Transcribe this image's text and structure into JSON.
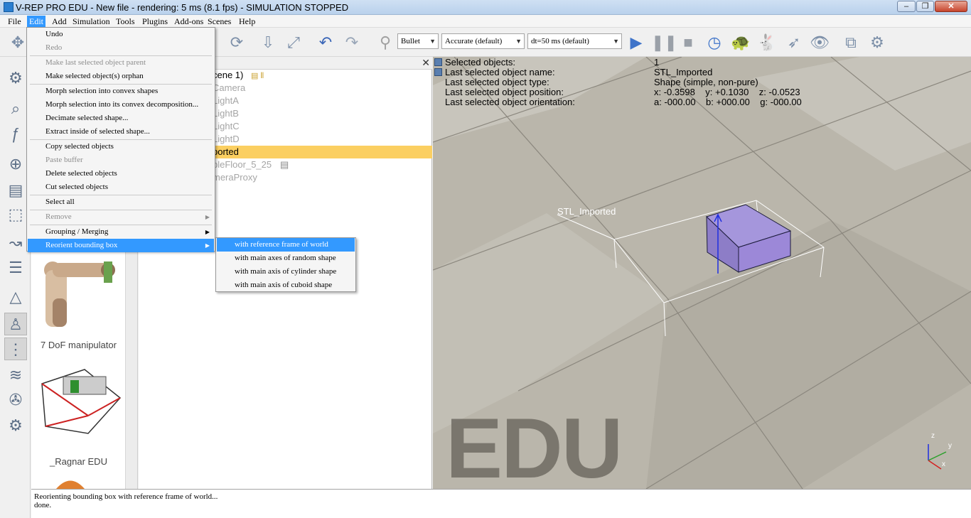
{
  "window": {
    "title": "V-REP PRO EDU - New file - rendering: 5 ms (8.1 fps) - SIMULATION STOPPED",
    "minimize": "–",
    "maximize": "❐",
    "close": "✕"
  },
  "menubar": [
    "File",
    "Edit",
    "Add",
    "Simulation",
    "Tools",
    "Plugins",
    "Add-ons",
    "Scenes",
    "Help"
  ],
  "toolbar": {
    "engine": "Bullet",
    "accuracy": "Accurate (default)",
    "timestep": "dt=50 ms (default)"
  },
  "edit_menu": {
    "undo": "Undo",
    "redo": "Redo",
    "make_parent": "Make last selected object parent",
    "make_orphan": "Make selected object(s) orphan",
    "morph_convex": "Morph selection into convex shapes",
    "morph_convex_decomp": "Morph selection into its convex decomposition...",
    "decimate": "Decimate selected shape...",
    "extract_inside": "Extract inside of selected shape...",
    "copy": "Copy selected objects",
    "paste": "Paste buffer",
    "delete": "Delete selected objects",
    "cut": "Cut selected objects",
    "select_all": "Select all",
    "remove": "Remove",
    "grouping": "Grouping / Merging",
    "reorient": "Reorient bounding box"
  },
  "reorient_submenu": [
    "with reference frame of world",
    "with main axes of random shape",
    "with main axis of cylinder shape",
    "with main axis of cuboid shape"
  ],
  "scene_tree": {
    "root": "cene 1)",
    "items": [
      "Camera",
      "LightA",
      "LightB",
      "LightC",
      "LightD",
      "ported",
      "bleFloor_5_25",
      "meraProxy"
    ]
  },
  "model_browser": {
    "items": [
      "7 DoF manipulator",
      "_Ragnar EDU"
    ]
  },
  "info_overlay": {
    "labels": [
      "Selected objects:",
      "Last selected object name:",
      "Last selected object type:",
      "Last selected object position:",
      "Last selected object orientation:"
    ],
    "values": [
      "1",
      "STL_Imported",
      "Shape (simple, non-pure)",
      "x: -0.3598    y: +0.1030    z: -0.0523",
      "a: -000.00    b: +000.00    g: -000.00"
    ]
  },
  "viewport": {
    "object_label": "STL_Imported",
    "watermark": "EDU",
    "axes": {
      "z": "z",
      "y": "y",
      "x": "x"
    }
  },
  "console": {
    "lines": [
      "Reorienting bounding box with reference frame of world...",
      "done."
    ]
  },
  "colors": {
    "selection": "#fbcf61",
    "menu_highlight": "#3399ff",
    "shape": "#9c88d8"
  }
}
